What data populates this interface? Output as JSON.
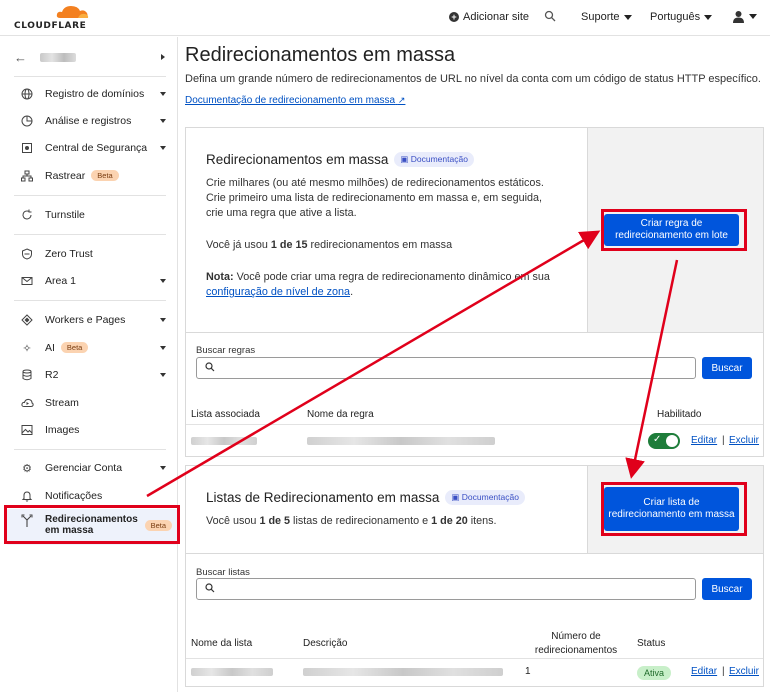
{
  "topbar": {
    "logo": "CLOUDFLARE",
    "add_site": "Adicionar site",
    "support": "Suporte",
    "language": "Português"
  },
  "sidebar": {
    "account_name": "",
    "items": [
      {
        "label": "Registro de domínios",
        "icon": "globe-icon"
      },
      {
        "label": "Análise e registros",
        "icon": "chart-icon"
      },
      {
        "label": "Central de Segurança",
        "icon": "shield-icon"
      },
      {
        "label": "Rastrear",
        "icon": "sitemap-icon",
        "badge": "Beta"
      },
      {
        "label": "Turnstile",
        "icon": "refresh-icon"
      },
      {
        "label": "Zero Trust",
        "icon": "zero-trust-icon"
      },
      {
        "label": "Area 1",
        "icon": "mail-icon"
      },
      {
        "label": "Workers e Pages",
        "icon": "workers-icon"
      },
      {
        "label": "AI",
        "icon": "sparkle-icon",
        "badge": "Beta"
      },
      {
        "label": "R2",
        "icon": "database-icon"
      },
      {
        "label": "Stream",
        "icon": "cloud-stream-icon"
      },
      {
        "label": "Images",
        "icon": "image-icon"
      },
      {
        "label": "Gerenciar Conta",
        "icon": "gear-icon"
      },
      {
        "label": "Notificações",
        "icon": "bell-icon"
      }
    ],
    "active_item": {
      "label": "Redirecionamentos em massa",
      "badge": "Beta",
      "icon": "redirect-icon"
    }
  },
  "main": {
    "title": "Redirecionamentos em massa",
    "description": "Defina um grande número de redirecionamentos de URL no nível da conta com um código de status HTTP específico.",
    "doc_link": "Documentação de redirecionamento em massa",
    "rules_card": {
      "heading": "Redirecionamentos em massa",
      "doc_badge": "Documentação",
      "text1": "Crie milhares (ou até mesmo milhões) de redirecionamentos estáticos. Crie primeiro uma lista de redirecionamento em massa e, em seguida, crie uma regra que ative a lista.",
      "usage_prefix": "Você já usou ",
      "usage_bold": "1 de 15",
      "usage_suffix": " redirecionamentos em massa",
      "note_bold": "Nota:",
      "note_text": " Você pode criar uma regra de redirecionamento dinâmico em sua ",
      "note_link": "configuração de nível de zona",
      "note_end": ".",
      "create_button": "Criar regra de redirecionamento em lote",
      "search_label": "Buscar regras",
      "search_button": "Buscar",
      "columns": [
        "Lista associada",
        "Nome da regra",
        "Habilitado"
      ],
      "row_actions": {
        "edit": "Editar",
        "delete": "Excluir",
        "sep": "|"
      }
    },
    "lists_card": {
      "heading": "Listas de Redirecionamento em massa",
      "doc_badge": "Documentação",
      "usage_prefix": "Você usou ",
      "usage_bold1": "1 de 5",
      "usage_mid": " listas de redirecionamento e ",
      "usage_bold2": "1 de 20",
      "usage_suffix": " itens.",
      "create_button": "Criar lista de redirecionamento em massa",
      "search_label": "Buscar listas",
      "search_button": "Buscar",
      "columns": [
        "Nome da lista",
        "Descrição",
        "Número de redirecionamentos",
        "Status"
      ],
      "row": {
        "count": "1",
        "status": "Ativa"
      },
      "row_actions": {
        "edit": "Editar",
        "delete": "Excluir",
        "sep": "|"
      }
    }
  },
  "colors": {
    "accent": "#0055dc",
    "highlight": "#e0001b",
    "toggle_on": "#1e7d3a"
  }
}
